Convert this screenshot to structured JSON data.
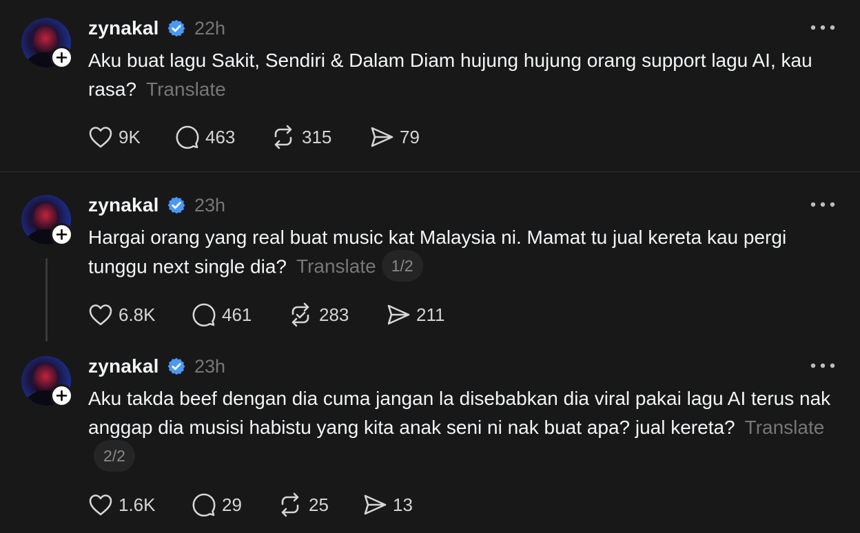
{
  "posts": [
    {
      "username": "zynakal",
      "time": "22h",
      "text": "Aku buat lagu Sakit, Sendiri & Dalam Diam hujung hujung orang support lagu AI, kau rasa?",
      "translate": "Translate",
      "pager": "",
      "likes": "9K",
      "replies": "463",
      "reposts": "315",
      "shares": "79"
    },
    {
      "username": "zynakal",
      "time": "23h",
      "text": "Hargai orang yang real buat music kat Malaysia ni. Mamat tu jual kereta kau pergi tunggu next single dia?",
      "translate": "Translate",
      "pager": "1/2",
      "likes": "6.8K",
      "replies": "461",
      "reposts": "283",
      "shares": "211"
    },
    {
      "username": "zynakal",
      "time": "23h",
      "text": "Aku takda beef dengan dia cuma jangan la disebabkan dia viral pakai lagu AI terus nak anggap dia musisi habistu yang kita anak seni ni nak buat apa? jual kereta?",
      "translate": "Translate",
      "pager": "2/2",
      "likes": "1.6K",
      "replies": "29",
      "reposts": "25",
      "shares": "13"
    }
  ],
  "icons": {
    "verified": "verified-badge-icon",
    "more": "more-options-icon",
    "follow": "follow-plus-icon",
    "like": "heart-icon",
    "reply": "reply-bubble-icon",
    "repost": "repost-icon",
    "share": "share-send-icon"
  },
  "colors": {
    "background": "#181818",
    "verified": "#4a98f7",
    "muted": "#777777",
    "text": "#f3f5f7"
  }
}
